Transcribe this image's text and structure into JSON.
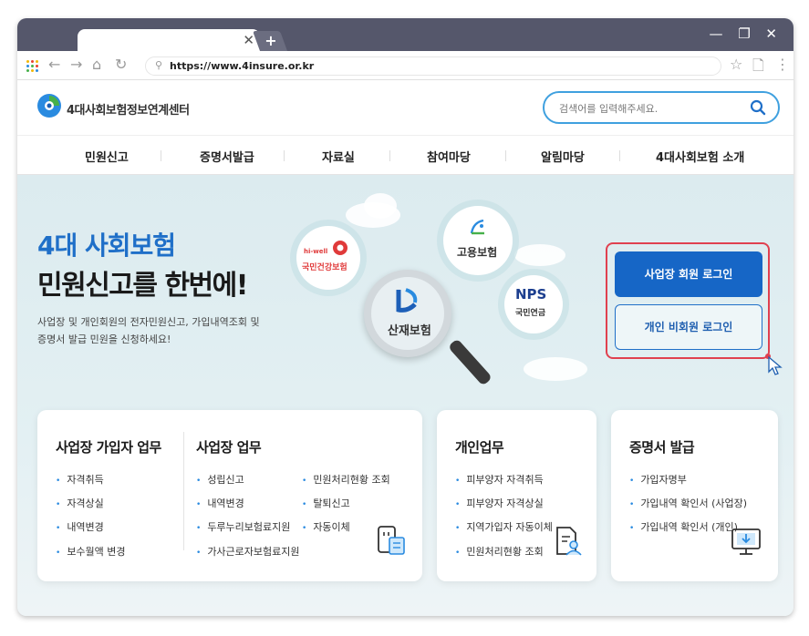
{
  "browser": {
    "url": "https://www.4insure.or.kr",
    "new_tab": "+",
    "tab_close": "✕",
    "win_controls": "— ❐ ✕"
  },
  "site": {
    "logo_text": "4대사회보험정보연계센터",
    "search_placeholder": "검색어를 입력해주세요."
  },
  "gnb": [
    "민원신고",
    "증명서발급",
    "자료실",
    "참여마당",
    "알림마당",
    "4대사회보험 소개"
  ],
  "hero": {
    "title_line1": "4대 사회보험",
    "title_line2": "민원신고를 한번에!",
    "desc_line1": "사업장 및 개인회원의 전자민원신고, 가입내역조회 및",
    "desc_line2": "증명서 발급 민원을 신청하세요!"
  },
  "insurers": {
    "health_brand": "hi-well",
    "health": "국민건강보험",
    "employment": "고용보험",
    "industrial": "산재보험",
    "pension_brand": "NPS",
    "pension": "국민연금"
  },
  "login": {
    "business_btn": "사업장 회원 로그인",
    "personal_btn": "개인 비회원 로그인"
  },
  "cards": {
    "c1_title": "사업장 가입자 업무",
    "c1_items": [
      "자격취득",
      "자격상실",
      "내역변경",
      "보수월액 변경"
    ],
    "c2_title": "사업장 업무",
    "c2_col1": [
      "성립신고",
      "내역변경",
      "두루누리보험료지원",
      "가사근로자보험료지원"
    ],
    "c2_col2": [
      "민원처리현황 조회",
      "탈퇴신고",
      "자동이체"
    ],
    "c3_title": "개인업무",
    "c3_items": [
      "피부양자 자격취득",
      "피부양자 자격상실",
      "지역가입자 자동이체",
      "민원처리현황 조회"
    ],
    "c4_title": "증명서 발급",
    "c4_items": [
      "가입자명부",
      "가입내역 확인서 (사업장)",
      "가입내역 확인서 (개인)"
    ]
  }
}
